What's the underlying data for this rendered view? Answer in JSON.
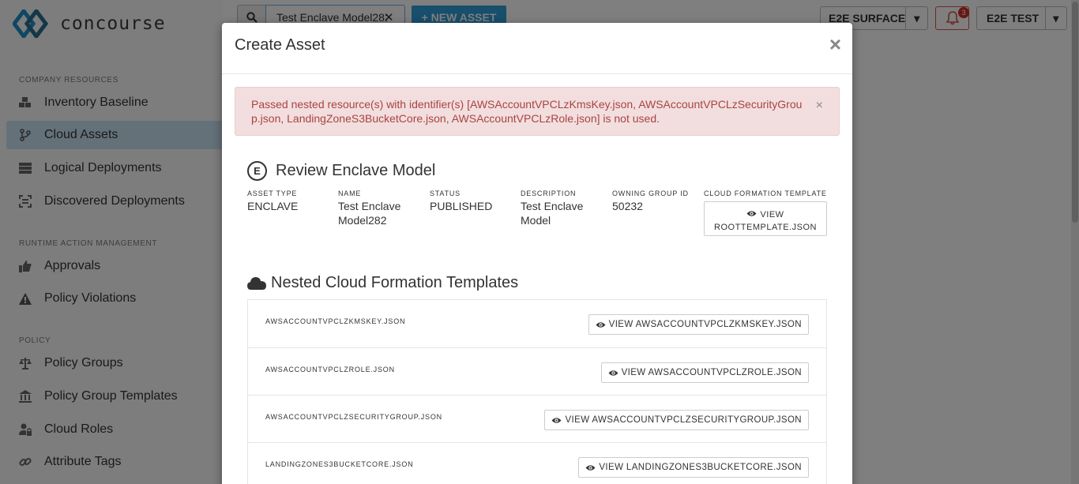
{
  "app": {
    "brand": "concourse"
  },
  "search": {
    "value": "Test Enclave Model282",
    "clear_glyph": "✕"
  },
  "toolbar": {
    "new_asset_label": "+ NEW ASSET"
  },
  "surface_select": {
    "value": "E2E SURFACE"
  },
  "notifications": {
    "count": "3"
  },
  "user_menu": {
    "value": "E2E TEST"
  },
  "sidebar": {
    "sections": [
      {
        "label": "COMPANY RESOURCES"
      },
      {
        "label": "RUNTIME ACTION MANAGEMENT"
      },
      {
        "label": "POLICY"
      }
    ],
    "items": [
      {
        "label": "Inventory Baseline",
        "icon": "cubes-icon"
      },
      {
        "label": "Cloud Assets",
        "icon": "branch-icon",
        "active": true
      },
      {
        "label": "Logical Deployments",
        "icon": "server-icon"
      },
      {
        "label": "Discovered Deployments",
        "icon": "scan-icon"
      },
      {
        "label": "Approvals",
        "icon": "thumbs-up-icon"
      },
      {
        "label": "Policy Violations",
        "icon": "warning-icon"
      },
      {
        "label": "Policy Groups",
        "icon": "scale-icon"
      },
      {
        "label": "Policy Group Templates",
        "icon": "bank-icon"
      },
      {
        "label": "Cloud Roles",
        "icon": "user-lock-icon"
      },
      {
        "label": "Attribute Tags",
        "icon": "link-icon"
      }
    ]
  },
  "modal": {
    "title": "Create Asset",
    "close_glyph": "×",
    "alert": {
      "text": "Passed nested resource(s) with identifier(s) [AWSAccountVPCLzKmsKey.json, AWSAccountVPCLzSecurityGroup.json, LandingZoneS3BucketCore.json, AWSAccountVPCLzRole.json] is not used.",
      "close_glyph": "×"
    },
    "review": {
      "badge": "E",
      "heading": "Review Enclave Model",
      "fields": [
        {
          "label": "ASSET TYPE",
          "value": "ENCLAVE"
        },
        {
          "label": "NAME",
          "value": "Test Enclave Model282"
        },
        {
          "label": "STATUS",
          "value": "PUBLISHED"
        },
        {
          "label": "DESCRIPTION",
          "value": "Test Enclave Model"
        },
        {
          "label": "OWNING GROUP ID",
          "value": "50232"
        }
      ],
      "template_label": "CLOUD FORMATION TEMPLATE",
      "template_button": "VIEW ROOTTEMPLATE.JSON"
    },
    "nested": {
      "heading": "Nested Cloud Formation Templates",
      "rows": [
        {
          "name": "AWSACCOUNTVPCLZKMSKEY.JSON",
          "button": "VIEW AWSACCOUNTVPCLZKMSKEY.JSON"
        },
        {
          "name": "AWSACCOUNTVPCLZROLE.JSON",
          "button": "VIEW AWSACCOUNTVPCLZROLE.JSON"
        },
        {
          "name": "AWSACCOUNTVPCLZSECURITYGROUP.JSON",
          "button": "VIEW AWSACCOUNTVPCLZSECURITYGROUP.JSON"
        },
        {
          "name": "LANDINGZONES3BUCKETCORE.JSON",
          "button": "VIEW LANDINGZONES3BUCKETCORE.JSON"
        }
      ]
    }
  },
  "colors": {
    "accent": "#2f9fd8",
    "active_nav": "#c9e3f3",
    "alert_bg": "#f2dede",
    "alert_text": "#a94442"
  }
}
